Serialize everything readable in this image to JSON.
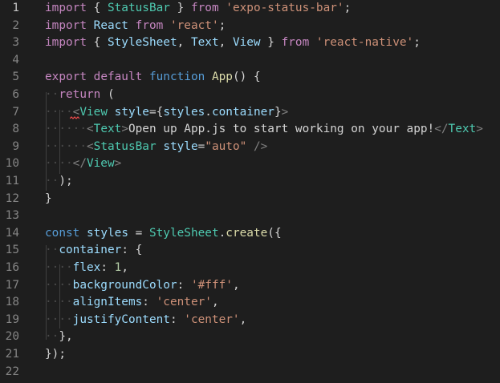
{
  "theme": {
    "background": "#1e1e1e",
    "line_number": "#858585",
    "keyword_control": "#c586c0",
    "keyword_storage": "#569cd6",
    "function": "#dcdcaa",
    "class_component": "#4ec9b0",
    "variable": "#9cdcfe",
    "string": "#ce9178",
    "number": "#b5cea8",
    "tag_punctuation": "#808080",
    "plain": "#d4d4d4",
    "whitespace": "#4a4a4a",
    "squiggle": "#f14c4c"
  },
  "editor": {
    "lines": [
      {
        "number": "1",
        "tokens": [
          [
            "kw",
            "import"
          ],
          [
            "pl",
            " { "
          ],
          [
            "cls",
            "StatusBar"
          ],
          [
            "pl",
            " } "
          ],
          [
            "kw",
            "from"
          ],
          [
            "pl",
            " "
          ],
          [
            "str",
            "'expo-status-bar'"
          ],
          [
            "pl",
            ";"
          ]
        ]
      },
      {
        "number": "2",
        "tokens": [
          [
            "kw",
            "import"
          ],
          [
            "pl",
            " "
          ],
          [
            "var",
            "React"
          ],
          [
            "pl",
            " "
          ],
          [
            "kw",
            "from"
          ],
          [
            "pl",
            " "
          ],
          [
            "str",
            "'react'"
          ],
          [
            "pl",
            ";"
          ]
        ]
      },
      {
        "number": "3",
        "tokens": [
          [
            "kw",
            "import"
          ],
          [
            "pl",
            " { "
          ],
          [
            "var",
            "StyleSheet"
          ],
          [
            "pl",
            ", "
          ],
          [
            "var",
            "Text"
          ],
          [
            "pl",
            ", "
          ],
          [
            "var",
            "View"
          ],
          [
            "pl",
            " } "
          ],
          [
            "kw",
            "from"
          ],
          [
            "pl",
            " "
          ],
          [
            "str",
            "'react-native'"
          ],
          [
            "pl",
            ";"
          ]
        ]
      },
      {
        "number": "4",
        "tokens": []
      },
      {
        "number": "5",
        "tokens": [
          [
            "kw",
            "export"
          ],
          [
            "pl",
            " "
          ],
          [
            "kw",
            "default"
          ],
          [
            "pl",
            " "
          ],
          [
            "st",
            "function"
          ],
          [
            "pl",
            " "
          ],
          [
            "fn",
            "App"
          ],
          [
            "pl",
            "() {"
          ]
        ]
      },
      {
        "number": "6",
        "tokens": [
          [
            "ws",
            "··"
          ],
          [
            "kw",
            "return"
          ],
          [
            "pl",
            " ("
          ]
        ]
      },
      {
        "number": "7",
        "tokens": [
          [
            "ws",
            "····"
          ],
          [
            "tagp",
            "<"
          ],
          [
            "cls",
            "View"
          ],
          [
            "pl",
            " "
          ],
          [
            "var",
            "style"
          ],
          [
            "pl",
            "={"
          ],
          [
            "var",
            "styles"
          ],
          [
            "pl",
            "."
          ],
          [
            "var",
            "container"
          ],
          [
            "pl",
            "}"
          ],
          [
            "tagp",
            ">"
          ]
        ]
      },
      {
        "number": "8",
        "tokens": [
          [
            "ws",
            "······"
          ],
          [
            "tagp",
            "<"
          ],
          [
            "cls",
            "Text"
          ],
          [
            "tagp",
            ">"
          ],
          [
            "pl",
            "Open up App.js to start working on your app!"
          ],
          [
            "tagp",
            "</"
          ],
          [
            "cls",
            "Text"
          ],
          [
            "tagp",
            ">"
          ]
        ]
      },
      {
        "number": "9",
        "tokens": [
          [
            "ws",
            "······"
          ],
          [
            "tagp",
            "<"
          ],
          [
            "cls",
            "StatusBar"
          ],
          [
            "pl",
            " "
          ],
          [
            "var",
            "style"
          ],
          [
            "pl",
            "="
          ],
          [
            "str",
            "\"auto\""
          ],
          [
            "pl",
            " "
          ],
          [
            "tagp",
            "/>"
          ]
        ]
      },
      {
        "number": "10",
        "tokens": [
          [
            "ws",
            "····"
          ],
          [
            "tagp",
            "</"
          ],
          [
            "cls",
            "View"
          ],
          [
            "tagp",
            ">"
          ]
        ]
      },
      {
        "number": "11",
        "tokens": [
          [
            "ws",
            "··"
          ],
          [
            "pl",
            ");"
          ]
        ]
      },
      {
        "number": "12",
        "tokens": [
          [
            "pl",
            "}"
          ]
        ]
      },
      {
        "number": "13",
        "tokens": []
      },
      {
        "number": "14",
        "tokens": [
          [
            "st",
            "const"
          ],
          [
            "pl",
            " "
          ],
          [
            "var",
            "styles"
          ],
          [
            "pl",
            " = "
          ],
          [
            "cls",
            "StyleSheet"
          ],
          [
            "pl",
            "."
          ],
          [
            "fn",
            "create"
          ],
          [
            "pl",
            "({"
          ]
        ]
      },
      {
        "number": "15",
        "tokens": [
          [
            "ws",
            "··"
          ],
          [
            "var",
            "container"
          ],
          [
            "pl",
            ": {"
          ]
        ]
      },
      {
        "number": "16",
        "tokens": [
          [
            "ws",
            "····"
          ],
          [
            "var",
            "flex"
          ],
          [
            "pl",
            ": "
          ],
          [
            "num",
            "1"
          ],
          [
            "pl",
            ","
          ]
        ]
      },
      {
        "number": "17",
        "tokens": [
          [
            "ws",
            "····"
          ],
          [
            "var",
            "backgroundColor"
          ],
          [
            "pl",
            ": "
          ],
          [
            "str",
            "'#fff'"
          ],
          [
            "pl",
            ","
          ]
        ]
      },
      {
        "number": "18",
        "tokens": [
          [
            "ws",
            "····"
          ],
          [
            "var",
            "alignItems"
          ],
          [
            "pl",
            ": "
          ],
          [
            "str",
            "'center'"
          ],
          [
            "pl",
            ","
          ]
        ]
      },
      {
        "number": "19",
        "tokens": [
          [
            "ws",
            "····"
          ],
          [
            "var",
            "justifyContent"
          ],
          [
            "pl",
            ": "
          ],
          [
            "str",
            "'center'"
          ],
          [
            "pl",
            ","
          ]
        ]
      },
      {
        "number": "20",
        "tokens": [
          [
            "ws",
            "··"
          ],
          [
            "pl",
            "},"
          ]
        ]
      },
      {
        "number": "21",
        "tokens": [
          [
            "pl",
            "});"
          ]
        ]
      },
      {
        "number": "22",
        "tokens": []
      }
    ]
  }
}
